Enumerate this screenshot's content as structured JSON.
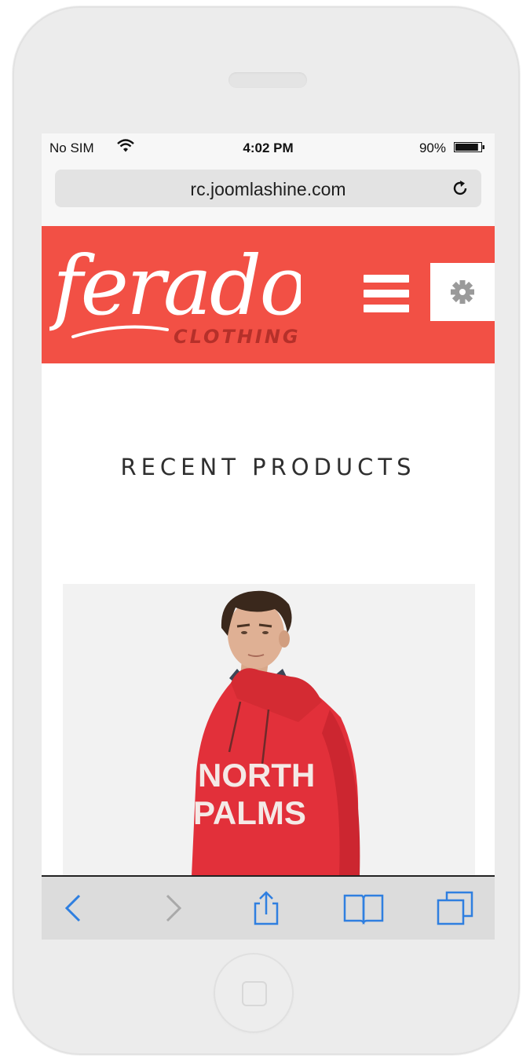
{
  "status_bar": {
    "carrier": "No SIM",
    "time": "4:02 PM",
    "battery_percent": "90%",
    "battery_level": 0.9
  },
  "browser": {
    "url": "rc.joomlashine.com",
    "icons": {
      "reload": "reload-icon",
      "back": "back-arrow-icon",
      "forward": "forward-arrow-icon",
      "share": "share-icon",
      "bookmarks": "bookmarks-book-icon",
      "tabs": "tabs-icon"
    }
  },
  "site": {
    "logo_script": "ferado",
    "logo_sub": "CLOTHING",
    "brand_color": "#f25045",
    "icons": {
      "menu": "hamburger-menu-icon",
      "settings": "gear-icon"
    }
  },
  "main": {
    "section_title": "RECENT PRODUCTS",
    "product": {
      "hoodie_text_line1": "NORTH",
      "hoodie_text_line2": "PALMS"
    }
  }
}
